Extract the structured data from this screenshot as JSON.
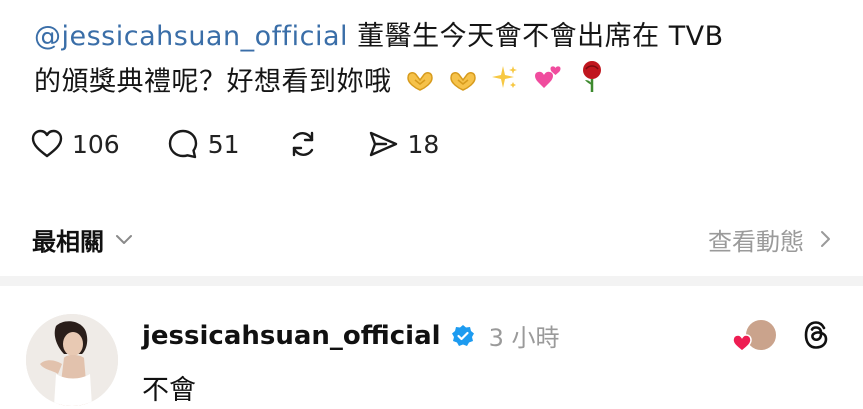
{
  "post": {
    "mention": "@jessicahsuan_official",
    "text_line1": "董醫生今天會不會出席在 TVB",
    "text_line2": "的頒獎典禮呢？好想看到妳哦",
    "emojis": [
      "heart-hands-icon",
      "heart-hands-icon",
      "sparkles-icon",
      "two-hearts-icon",
      "rose-icon"
    ]
  },
  "actions": {
    "like_count": "106",
    "comment_count": "51",
    "share_count": "18"
  },
  "sort": {
    "label": "最相關",
    "view_activity": "查看動態"
  },
  "reply": {
    "username": "jessicahsuan_official",
    "time": "3 小時",
    "text": "不會"
  },
  "colors": {
    "mention": "#3a6ea8",
    "verified": "#1d9bf0",
    "muted": "#9a9a9a"
  }
}
